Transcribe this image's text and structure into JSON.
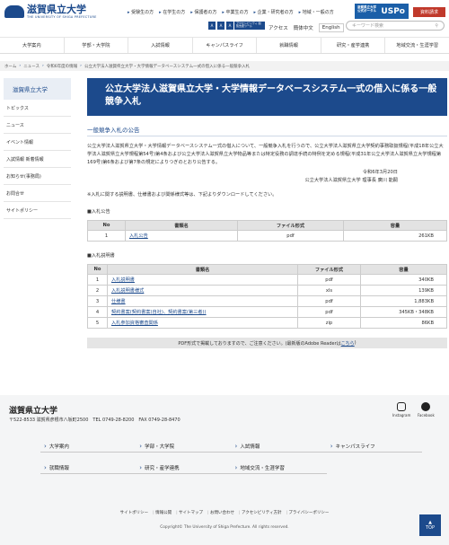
{
  "header": {
    "logo_text": "滋賀県立大学",
    "logo_sub": "THE UNIVERSITY OF SHIGA PREFECTURE",
    "top_links": [
      "受験生の方",
      "在学生の方",
      "保護者の方",
      "卒業生の方",
      "企業・研究者の方",
      "地域・一般の方"
    ],
    "uspo_small": "滋賀県立大学 公式ポータル",
    "uspo_label": "USPo",
    "request_button": "資料請求",
    "acc_icons": [
      "A",
      "A",
      "A"
    ],
    "acc_banner": "アクセシビリティ 閲覧支援ツール",
    "access": "アクセス",
    "lang_jp": "簡体中文",
    "lang_en": "English",
    "search_placeholder": "キーワード検索"
  },
  "nav": [
    "大学案内",
    "学部・大学院",
    "入試情報",
    "キャンパスライフ",
    "就職情報",
    "研究・産学連携",
    "地域交流・生涯学習"
  ],
  "breadcrumb": [
    "ホーム",
    "ニュース",
    "令和6年度の情報",
    "公立大学法人滋賀県立大学・大学情報データベースシステム一式の借入に係る一般競争入札"
  ],
  "sidebar": {
    "title": "滋賀県立大学",
    "items": [
      "トピックス",
      "ニュース",
      "イベント情報",
      "入試情報 新着情報",
      "お知らせ(事務局)",
      "お問合せ",
      "サイトポリシー"
    ]
  },
  "main": {
    "title": "公立大学法人滋賀県立大学・大学情報データベースシステム一式の借入に係る一般競争入札",
    "section_title": "一般競争入札の公告",
    "para1": "公立大学法人滋賀県立大学・大学情報データベースシステム一式の借入について、一般競争入札を行うので、公立大学法人滋賀県立大学契約事務取扱規程(平成18年公立大学法人滋賀県立大学規程第54号)第4条および公立大学法人滋賀県立大学物品等または特定役務の調達手続の特例を定める規程(平成31年公立大学法人滋賀県立大学規程第169号)第6条および第7条の規定によりつぎのとおり公告する。",
    "date": "令和6年3月20日",
    "signer": "公立大学法人滋賀県立大学 理事長 廣川 能嗣",
    "para2": "※入札に関する説明書、仕様書および関係様式等は、下記よりダウンロードしてください。",
    "table1_title": "■入札公告",
    "table1_headers": [
      "No",
      "書類名",
      "ファイル形式",
      "容量"
    ],
    "table1_rows": [
      {
        "no": "1",
        "name": "入札公告",
        "type": "pdf",
        "size": "261KB"
      }
    ],
    "table2_title": "■入札説明書",
    "table2_headers": [
      "No",
      "書類名",
      "ファイル形式",
      "容量"
    ],
    "table2_rows": [
      {
        "no": "1",
        "name": "入札説明書",
        "type": "pdf",
        "size": "340KB"
      },
      {
        "no": "2",
        "name": "入札説明書様式",
        "type": "xls",
        "size": "139KB"
      },
      {
        "no": "3",
        "name": "仕様書",
        "type": "pdf",
        "size": "1,883KB"
      },
      {
        "no": "4",
        "name": "契約書案(契約書案(自社)、契約書案(第三者))",
        "type": "pdf",
        "size": "345KB・348KB"
      },
      {
        "no": "5",
        "name": "入札参加資格審査関係",
        "type": "zip",
        "size": "86KB"
      }
    ],
    "pdf_note_text": "PDF形式で掲載しておりますので、ご注意ください。(最新版のAdobe Readerは",
    "pdf_note_link": "こちら",
    "pdf_note_end": ")"
  },
  "footer": {
    "name": "滋賀県立大学",
    "address": "〒522-8533 滋賀県彦根市八坂町2500　TEL 0749-28-8200　FAX 0749-28-8470",
    "sns": [
      "Instagram",
      "Facebook"
    ],
    "links": [
      "大学案内",
      "学部・大学院",
      "入試情報",
      "キャンパスライフ",
      "就職情報",
      "研究・産学連携",
      "地域交流・生涯学習"
    ],
    "bottom_links": [
      "サイトポリシー",
      "情報公開",
      "サイトマップ",
      "お問い合わせ",
      "アクセシビリティ方針",
      "プライバシーポリシー"
    ],
    "copyright": "Copyright© The University of Shiga Prefecture. All rights reserved.",
    "to_top": "TOP"
  },
  "colors": {
    "brand": "#1c4a8c",
    "request": "#c0392b"
  }
}
